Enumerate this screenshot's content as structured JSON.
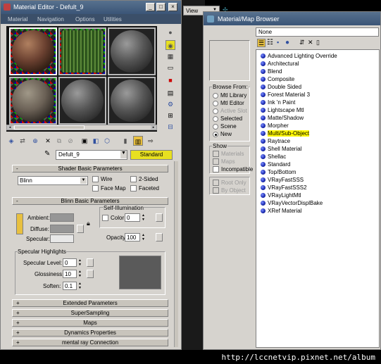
{
  "material_editor": {
    "title": "Material Editor - Defult_9",
    "menu": [
      "Material",
      "Navigation",
      "Options",
      "Utilities"
    ],
    "material_name": "Defult_9",
    "type_button": "Standard",
    "shader_rollout": "Shader Basic Parameters",
    "shader_type": "Blinn",
    "shader_options": [
      "Wire",
      "2-Sided",
      "Face Map",
      "Faceted"
    ],
    "blinn_rollout": "Blinn Basic Parameters",
    "color_labels": [
      "Ambient:",
      "Diffuse:",
      "Specular:"
    ],
    "self_illum_title": "Self-Illumination",
    "self_illum_color_label": "Color",
    "self_illum_value": "0",
    "opacity_label": "Opacity:",
    "opacity_value": "100",
    "specular_title": "Specular Highlights",
    "specular_level_label": "Specular Level:",
    "specular_level_value": "0",
    "glossiness_label": "Glossiness:",
    "glossiness_value": "10",
    "soften_label": "Soften:",
    "soften_value": "0.1",
    "collapsed_rollouts": [
      "Extended Parameters",
      "SuperSampling",
      "Maps",
      "Dynamics Properties",
      "mental ray Connection"
    ],
    "colors": {
      "titlebar": "#3b5577",
      "standard_button": "#e8e020"
    }
  },
  "viewport": {
    "view_dropdown": "View"
  },
  "browser": {
    "title": "Material/Map Browser",
    "current": "None",
    "browse_from_title": "Browse From:",
    "browse_from": [
      {
        "label": "Mtl Library",
        "selected": false,
        "enabled": true
      },
      {
        "label": "Mtl Editor",
        "selected": false,
        "enabled": true
      },
      {
        "label": "Active Slot",
        "selected": false,
        "enabled": false
      },
      {
        "label": "Selected",
        "selected": false,
        "enabled": true
      },
      {
        "label": "Scene",
        "selected": false,
        "enabled": true
      },
      {
        "label": "New",
        "selected": true,
        "enabled": true
      }
    ],
    "show_title": "Show",
    "show": [
      {
        "label": "Materials",
        "enabled": false
      },
      {
        "label": "Maps",
        "enabled": false
      },
      {
        "label": "Incompatible",
        "enabled": true
      }
    ],
    "extra": [
      {
        "label": "Root Only",
        "enabled": false
      },
      {
        "label": "By Object",
        "enabled": false
      }
    ],
    "items": [
      "Advanced Lighting Override",
      "Architectural",
      "Blend",
      "Composite",
      "Double Sided",
      "Forest Material 3",
      "Ink 'n Paint",
      "Lightscape Mtl",
      "Matte/Shadow",
      "Morpher",
      "Multi/Sub-Object",
      "Raytrace",
      "Shell Material",
      "Shellac",
      "Standard",
      "Top/Bottom",
      "VRayFastSSS",
      "VRayFastSSS2",
      "VRayLightMtl",
      "VRayVectorDisplBake",
      "XRef Material"
    ],
    "selected_item": "Multi/Sub-Object",
    "highlight_color": "#fff800"
  },
  "watermark": "http://lccnetvip.pixnet.net/album"
}
